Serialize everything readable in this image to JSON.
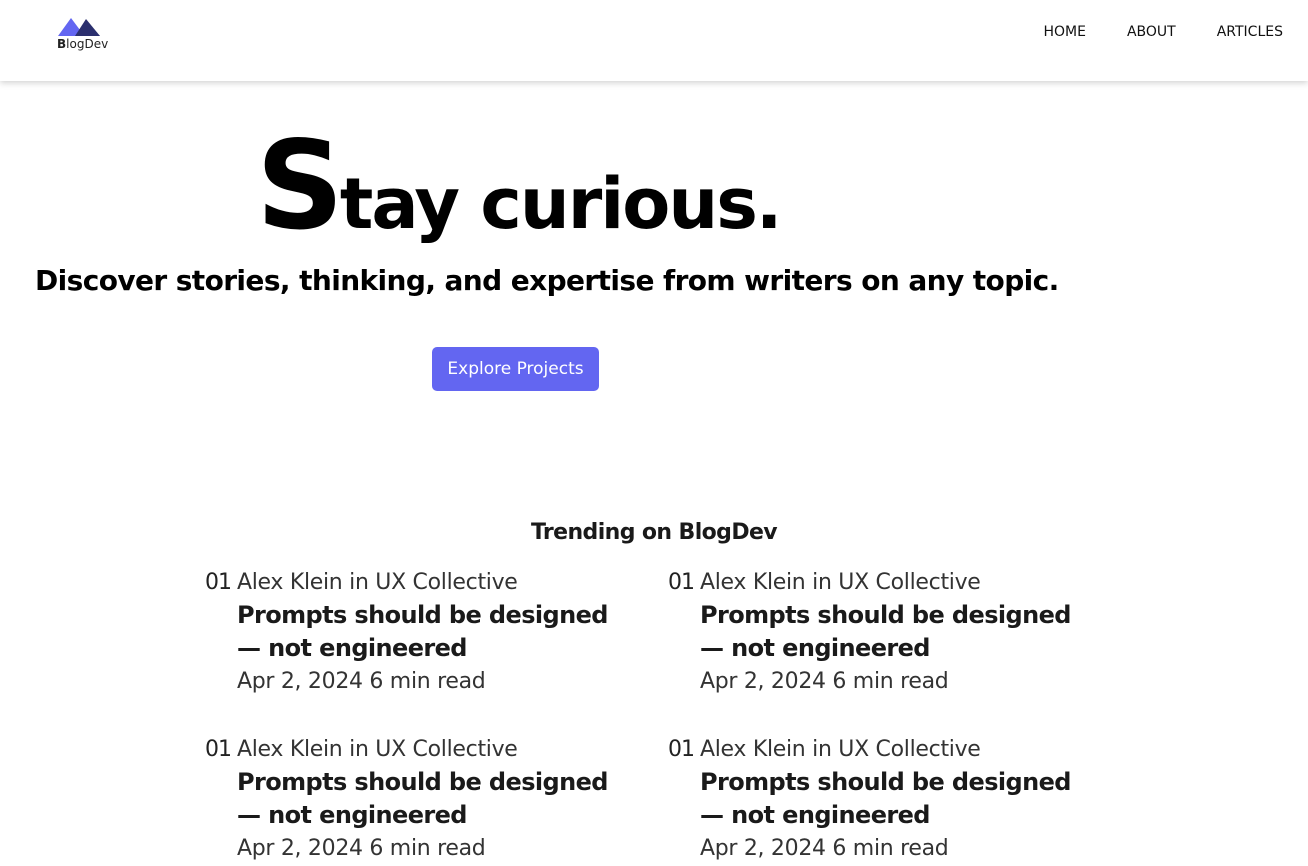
{
  "brand": {
    "logo_text_bold": "B",
    "logo_text_rest": "logDev",
    "accent_color": "#6366f1"
  },
  "nav": {
    "items": [
      {
        "label": "HOME"
      },
      {
        "label": "ABOUT"
      },
      {
        "label": "ARTICLES"
      }
    ]
  },
  "hero": {
    "title_first_letter": "S",
    "title_rest": "tay curious.",
    "subtitle": "Discover stories, thinking, and expertise from writers on any topic.",
    "cta_label": "Explore Projects"
  },
  "trending": {
    "heading": "Trending on BlogDev",
    "articles": [
      {
        "rank": "01",
        "author_line": "Alex Klein in UX Collective",
        "title": "Prompts should be designed — not engineered",
        "meta": "Apr 2, 2024 6 min read"
      },
      {
        "rank": "01",
        "author_line": "Alex Klein in UX Collective",
        "title": "Prompts should be designed — not engineered",
        "meta": "Apr 2, 2024 6 min read"
      },
      {
        "rank": "01",
        "author_line": "Alex Klein in UX Collective",
        "title": "Prompts should be designed — not engineered",
        "meta": "Apr 2, 2024 6 min read"
      },
      {
        "rank": "01",
        "author_line": "Alex Klein in UX Collective",
        "title": "Prompts should be designed — not engineered",
        "meta": "Apr 2, 2024 6 min read"
      }
    ]
  }
}
